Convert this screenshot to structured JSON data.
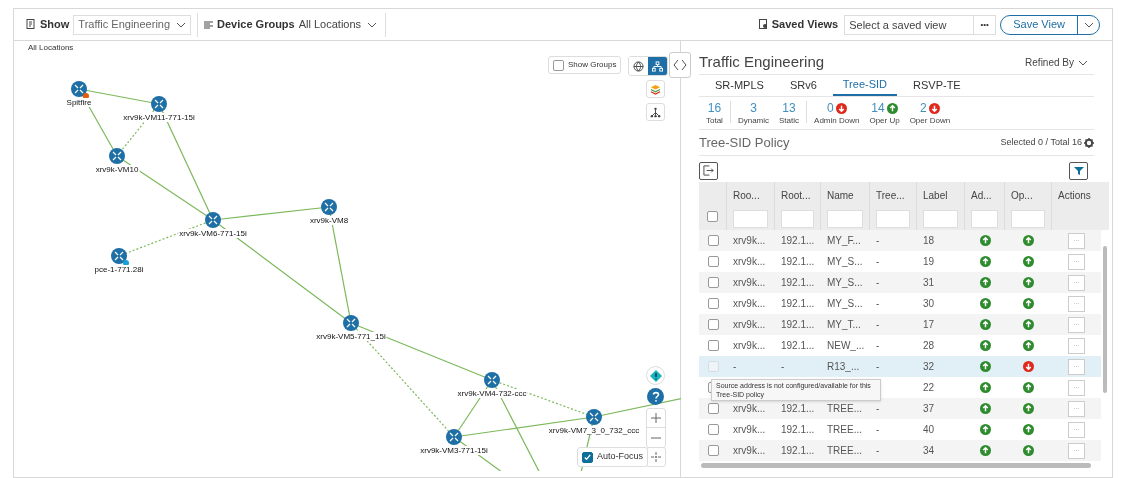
{
  "toolbar": {
    "show_label": "Show",
    "show_value": "Traffic Engineering",
    "groups_label": "Device Groups",
    "groups_value": "All Locations",
    "saved_views_label": "Saved Views",
    "saved_view_placeholder": "Select a saved view",
    "more": "•••",
    "save_button": "Save View"
  },
  "map": {
    "location": "All Locations",
    "show_groups": {
      "label": "Show Groups",
      "checked": false
    },
    "view_toggle": [
      {
        "kind": "globe",
        "selected": false
      },
      {
        "kind": "topology",
        "selected": true
      }
    ],
    "auto_focus": {
      "label": "Auto-Focus",
      "checked": true
    },
    "nodes": [
      {
        "label": "Spitfire",
        "kind": "alert"
      },
      {
        "label": "xrv9k-VM11-771-15i",
        "kind": "plain"
      },
      {
        "label": "xrv9k-VM10",
        "kind": "plain"
      },
      {
        "label": "xrv9k-VM6-771-15i",
        "kind": "plain"
      },
      {
        "label": "xrv9k-VM8",
        "kind": "plain"
      },
      {
        "label": "pce-1-771.28i",
        "kind": "info"
      },
      {
        "label": "xrv9k-VM5-771_15i",
        "kind": "plain"
      },
      {
        "label": "xrv9k-VM4-732-ccc",
        "kind": "plain"
      },
      {
        "label": "xrv9k-VM7_3_0_732_ccc",
        "kind": "plain"
      },
      {
        "label": "xrv9k-VM3-771-15i",
        "kind": "plain"
      }
    ]
  },
  "panel": {
    "title": "Traffic Engineering",
    "refined_by": "Refined By",
    "tabs": [
      {
        "label": "SR-MPLS",
        "selected": false
      },
      {
        "label": "SRv6",
        "selected": false
      },
      {
        "label": "Tree-SID",
        "selected": true
      },
      {
        "label": "RSVP-TE",
        "selected": false
      }
    ],
    "stats": [
      {
        "value": "16",
        "label": "Total",
        "kind": "plain"
      },
      {
        "value": "3",
        "label": "Dynamic",
        "kind": "plain"
      },
      {
        "value": "13",
        "label": "Static",
        "kind": "plain"
      },
      {
        "value": "0",
        "label": "Admin Down",
        "kind": "down"
      },
      {
        "value": "14",
        "label": "Oper Up",
        "kind": "up"
      },
      {
        "value": "2",
        "label": "Oper Down",
        "kind": "down"
      }
    ],
    "section_title": "Tree-SID Policy",
    "selection": "Selected 0 / Total 16",
    "table": {
      "select_all_checked": false,
      "columns": [
        "Roo...",
        "Root...",
        "Name",
        "Tree...",
        "Label",
        "Ad...",
        "Op...",
        "Actions"
      ],
      "rows": [
        {
          "root": "xrv9k...",
          "root_ip": "192.1...",
          "name": "MY_F...",
          "tree": "-",
          "label": "18",
          "admin_up": true,
          "oper_up": true,
          "checked": false,
          "disabled": false
        },
        {
          "root": "xrv9k...",
          "root_ip": "192.1...",
          "name": "MY_S...",
          "tree": "-",
          "label": "19",
          "admin_up": true,
          "oper_up": true,
          "checked": false,
          "disabled": false
        },
        {
          "root": "xrv9k...",
          "root_ip": "192.1...",
          "name": "MY_S...",
          "tree": "-",
          "label": "31",
          "admin_up": true,
          "oper_up": true,
          "checked": false,
          "disabled": false
        },
        {
          "root": "xrv9k...",
          "root_ip": "192.1...",
          "name": "MY_S...",
          "tree": "-",
          "label": "30",
          "admin_up": true,
          "oper_up": true,
          "checked": false,
          "disabled": false
        },
        {
          "root": "xrv9k...",
          "root_ip": "192.1...",
          "name": "MY_T...",
          "tree": "-",
          "label": "17",
          "admin_up": true,
          "oper_up": true,
          "checked": false,
          "disabled": false
        },
        {
          "root": "xrv9k...",
          "root_ip": "192.1...",
          "name": "NEW_...",
          "tree": "-",
          "label": "28",
          "admin_up": true,
          "oper_up": true,
          "checked": false,
          "disabled": false
        },
        {
          "root": "-",
          "root_ip": "-",
          "name": "R13_...",
          "tree": "-",
          "label": "32",
          "admin_up": true,
          "oper_up": false,
          "checked": false,
          "disabled": true
        },
        {
          "label": "22",
          "admin_up": true,
          "oper_up": true,
          "checked": false,
          "disabled": false
        },
        {
          "root": "xrv9k...",
          "root_ip": "192.1...",
          "name": "TREE...",
          "tree": "-",
          "label": "37",
          "admin_up": true,
          "oper_up": true,
          "checked": false,
          "disabled": false
        },
        {
          "root": "xrv9k...",
          "root_ip": "192.1...",
          "name": "TREE...",
          "tree": "-",
          "label": "40",
          "admin_up": true,
          "oper_up": true,
          "checked": false,
          "disabled": false
        },
        {
          "root": "xrv9k...",
          "root_ip": "192.1...",
          "name": "TREE...",
          "tree": "-",
          "label": "34",
          "admin_up": true,
          "oper_up": true,
          "checked": false,
          "disabled": false
        }
      ],
      "actions_label": "···",
      "tooltip": "Source address is not configured/available for this Tree-SID policy"
    }
  }
}
